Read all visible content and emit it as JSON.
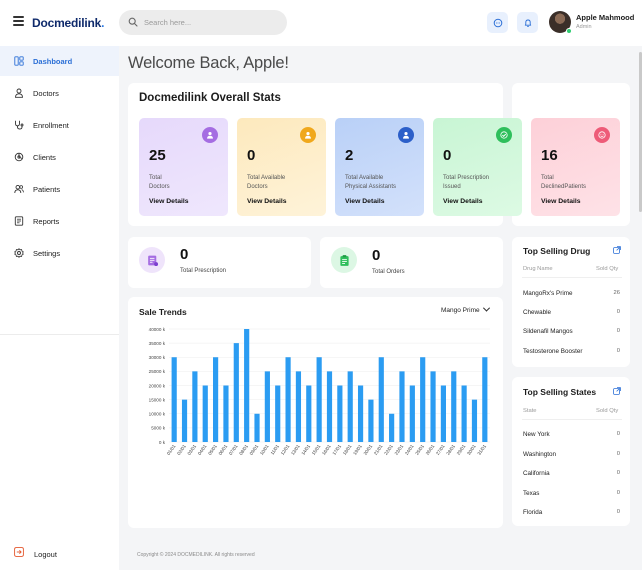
{
  "header": {
    "logo_main": "Docmedilink",
    "logo_dot": ".",
    "search_placeholder": "Search here...",
    "user_name": "Apple Mahmood",
    "user_role": "Admin"
  },
  "sidebar": {
    "items": [
      {
        "label": "Dashboard",
        "icon": "dashboard-icon"
      },
      {
        "label": "Doctors",
        "icon": "doctor-icon"
      },
      {
        "label": "Enrollment",
        "icon": "stethoscope-icon"
      },
      {
        "label": "Clients",
        "icon": "clients-icon"
      },
      {
        "label": "Patients",
        "icon": "patients-icon"
      },
      {
        "label": "Reports",
        "icon": "reports-icon"
      },
      {
        "label": "Settings",
        "icon": "gear-icon"
      }
    ],
    "logout_label": "Logout"
  },
  "main": {
    "welcome": "Welcome Back, Apple!",
    "stats_title": "Docmedilink Overall Stats",
    "stats": [
      {
        "value": "25",
        "label": "Total Doctors",
        "line1": "Total",
        "line2": "Doctors",
        "link": "View Details",
        "icon": "doctor-icon",
        "color": "#a56de2"
      },
      {
        "value": "0",
        "label": "Total Available Doctors",
        "line1": "Total Available",
        "line2": "Doctors",
        "link": "View Details",
        "icon": "doctor-icon",
        "color": "#f0a81c"
      },
      {
        "value": "2",
        "label": "Total Available Physical Assistants",
        "line1": "Total Available",
        "line2": "Physical Assistants",
        "link": "View Details",
        "icon": "assistant-icon",
        "color": "#2c5fc9"
      },
      {
        "value": "0",
        "label": "Total Prescription Issued",
        "line1": "Total Prescription",
        "line2": "Issued",
        "link": "View Details",
        "icon": "check-icon",
        "color": "#2fbf5c"
      },
      {
        "value": "16",
        "label": "Total DeclinedPatients",
        "line1": "Total",
        "line2": "DeclinedPatients",
        "link": "View Details",
        "icon": "smile-icon",
        "color": "#ee5b78"
      }
    ],
    "mini": [
      {
        "value": "0",
        "label": "Total Prescription",
        "icon": "prescription-icon"
      },
      {
        "value": "0",
        "label": "Total Orders",
        "icon": "clipboard-icon"
      }
    ]
  },
  "top_drug": {
    "title": "Top Selling Drug",
    "col_name": "Drug Name",
    "col_qty": "Sold Qty",
    "rows": [
      {
        "name": "MangoRx's Prime",
        "qty": "26"
      },
      {
        "name": "Chewable",
        "qty": "0"
      },
      {
        "name": "Sildenafil Mangos",
        "qty": "0"
      },
      {
        "name": "Testosterone Booster",
        "qty": "0"
      }
    ]
  },
  "top_states": {
    "title": "Top Selling States",
    "col_name": "State",
    "col_qty": "Sold Qty",
    "rows": [
      {
        "name": "New York",
        "qty": "0"
      },
      {
        "name": "Washington",
        "qty": "0"
      },
      {
        "name": "California",
        "qty": "0"
      },
      {
        "name": "Texas",
        "qty": "0"
      },
      {
        "name": "Florida",
        "qty": "0"
      }
    ]
  },
  "sale_trends": {
    "title": "Sale Trends",
    "selected": "Mango Prime"
  },
  "chart_data": {
    "type": "bar",
    "title": "Sale Trends",
    "xlabel": "",
    "ylabel": "",
    "ylim": [
      0,
      40000
    ],
    "y_ticks": [
      0,
      5000,
      10000,
      15000,
      20000,
      25000,
      30000,
      35000,
      40000
    ],
    "y_tick_labels": [
      "0 k",
      "5000 k",
      "10000 k",
      "15000 k",
      "20000 k",
      "25000 k",
      "30000 k",
      "35000 k",
      "40000 k"
    ],
    "grid": true,
    "bar_color": "#2b9cf2",
    "categories": [
      "01/01",
      "02/01",
      "03/01",
      "04/01",
      "05/01",
      "06/01",
      "07/01",
      "08/01",
      "09/01",
      "10/01",
      "11/01",
      "12/01",
      "13/01",
      "14/01",
      "15/01",
      "16/01",
      "17/01",
      "18/01",
      "19/01",
      "20/01",
      "21/01",
      "22/01",
      "23/01",
      "24/01",
      "25/01",
      "26/01",
      "27/01",
      "28/01",
      "29/01",
      "30/01",
      "31/01"
    ],
    "values": [
      30000,
      15000,
      25000,
      20000,
      30000,
      20000,
      35000,
      40000,
      10000,
      25000,
      20000,
      30000,
      25000,
      20000,
      30000,
      25000,
      20000,
      25000,
      20000,
      15000,
      30000,
      10000,
      25000,
      20000,
      30000,
      25000,
      20000,
      25000,
      20000,
      15000,
      30000
    ]
  },
  "footer": {
    "copyright": "Copyright © 2024 DOCMEDILINK. All rights reserved"
  }
}
